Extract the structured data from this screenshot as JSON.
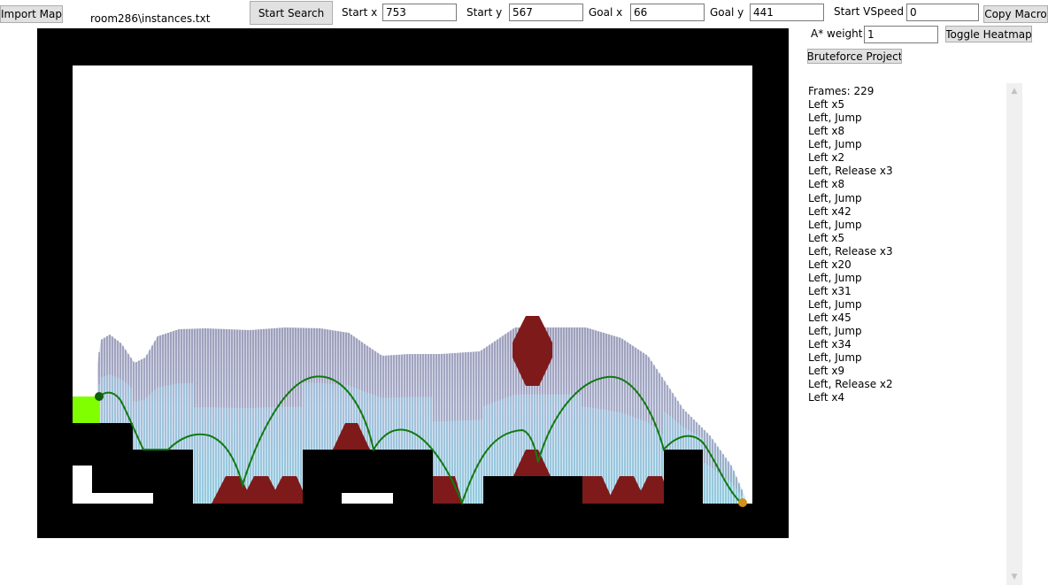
{
  "toolbar": {
    "import_map_label": "Import Map",
    "file_name": "room286\\instances.txt",
    "start_search_label": "Start Search",
    "start_x_label": "Start x",
    "start_x_value": "753",
    "start_y_label": "Start y",
    "start_y_value": "567",
    "goal_x_label": "Goal x",
    "goal_x_value": "66",
    "goal_y_label": "Goal y",
    "goal_y_value": "441",
    "start_vspeed_label": "Start VSpeed",
    "start_vspeed_value": "0",
    "copy_macro_label": "Copy Macro",
    "astar_weight_label": "A* weight",
    "astar_weight_value": "1",
    "toggle_heatmap_label": "Toggle Heatmap",
    "bruteforce_label": "Bruteforce Project"
  },
  "macro": {
    "lines": [
      "Frames: 229",
      "Left x5",
      "Left, Jump",
      "Left x8",
      "Left, Jump",
      "Left x2",
      "Left, Release x3",
      "Left x8",
      "Left, Jump",
      "Left x42",
      "Left, Jump",
      "Left x5",
      "Left, Release x3",
      "Left x20",
      "Left, Jump",
      "Left x31",
      "Left, Jump",
      "Left x45",
      "Left, Jump",
      "Left x34",
      "Left, Jump",
      "Left x9",
      "Left, Release x2",
      "Left x4"
    ]
  },
  "colors": {
    "wall": "#000000",
    "spike": "#7f1a1a",
    "goal_block": "#80ff00",
    "path": "#117a11",
    "start_marker": "#d4901a",
    "goal_marker": "#0f5f0f"
  }
}
